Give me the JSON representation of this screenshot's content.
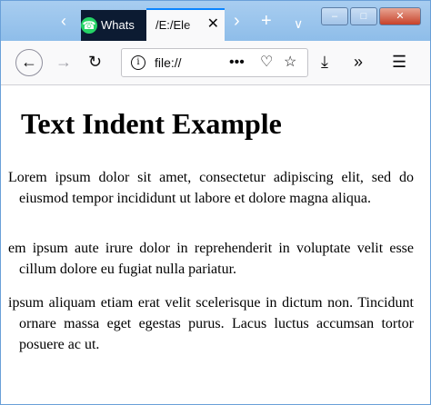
{
  "browser": {
    "tabs": [
      {
        "label": "Whats",
        "active": false,
        "icon": "whatsapp-icon"
      },
      {
        "label": "/E:/Ele",
        "active": true
      }
    ],
    "url": "file://",
    "icons": {
      "tab_scroll_left": "chevron-left-icon",
      "tab_scroll_right": "chevron-right-icon",
      "new_tab": "plus-icon",
      "tab_list": "chevron-down-icon",
      "back": "arrow-left-icon",
      "forward": "arrow-right-icon",
      "reload": "reload-icon",
      "site_info": "info-icon",
      "page_actions": "more-dots-icon",
      "pocket": "pocket-icon",
      "bookmark": "star-icon",
      "downloads": "download-icon",
      "overflow": "double-chevron-icon",
      "menu": "hamburger-menu-icon"
    },
    "colors": {
      "titlebar": "#99c5ec",
      "active_tab_accent": "#0a84ff",
      "inactive_tab": "#0c1b32",
      "close_button": "#c7422a"
    }
  },
  "page": {
    "title": "Text Indent Example",
    "paragraphs": [
      "Lorem ipsum dolor sit amet, consectetur adipiscing elit, sed do eiusmod tempor incididunt ut labore et dolore magna aliqua.",
      "em ipsum aute irure dolor in reprehenderit in voluptate velit esse cillum dolore eu fugiat nulla pariatur.",
      "ipsum aliquam etiam erat velit scelerisque in dictum non. Tincidunt ornare massa eget egestas purus. Lacus luctus accumsan tortor posuere ac ut."
    ]
  }
}
